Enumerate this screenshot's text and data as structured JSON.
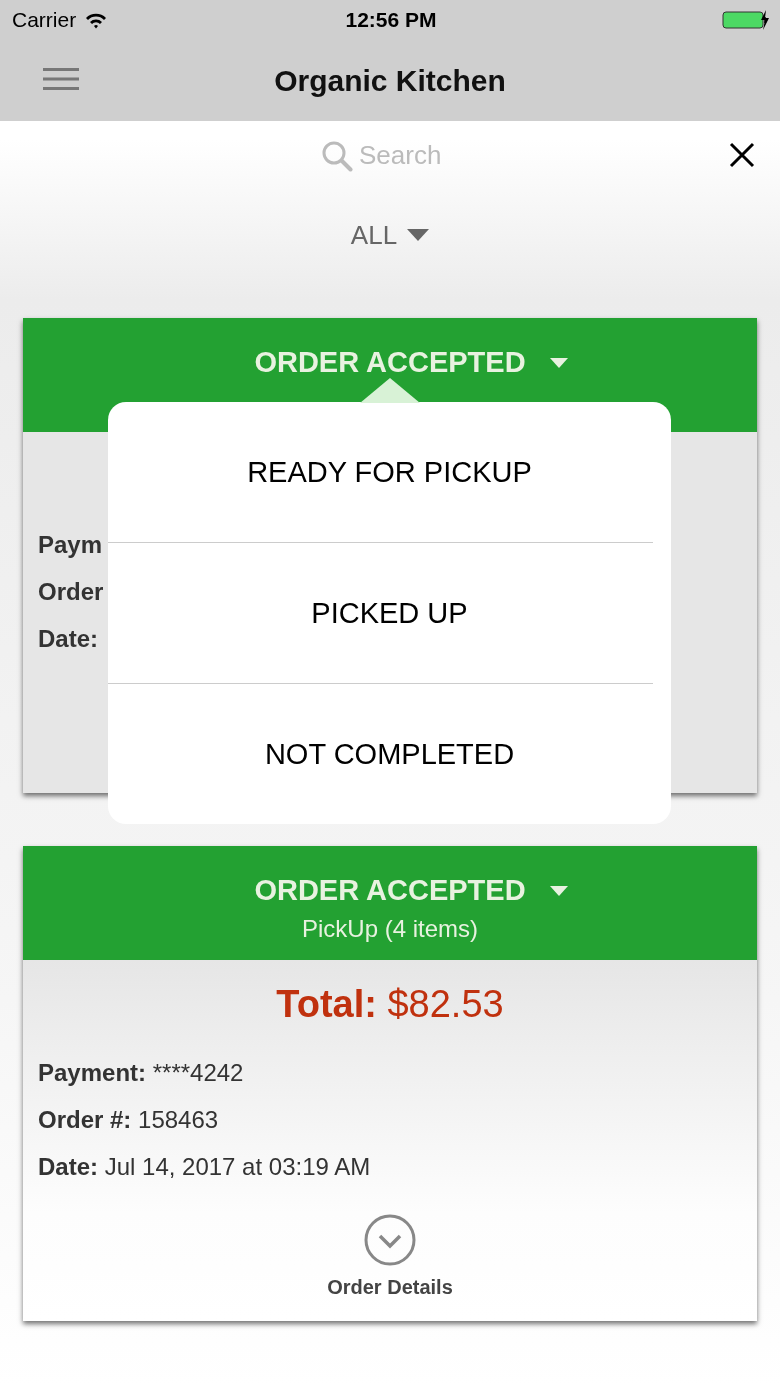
{
  "status_bar": {
    "carrier": "Carrier",
    "time": "12:56 PM"
  },
  "nav": {
    "title": "Organic Kitchen"
  },
  "search": {
    "placeholder": "Search"
  },
  "filter": {
    "label": "ALL"
  },
  "orders": [
    {
      "status": "ORDER ACCEPTED",
      "rows": [
        {
          "label": "Paym"
        },
        {
          "label": "Order"
        },
        {
          "label": "Date:"
        }
      ]
    },
    {
      "status": "ORDER ACCEPTED",
      "subtitle": "PickUp (4 items)",
      "total": "**Total:** $82.53",
      "rows": [
        {
          "label": "Payment:",
          "value": "****4242"
        },
        {
          "label": "Order #:",
          "value": "158463"
        },
        {
          "label": "Date:",
          "value": "Jul 14, 2017 at 03:19 AM"
        }
      ],
      "details": "Order Details"
    }
  ],
  "status_menu": {
    "items": [
      "READY FOR PICKUP",
      "PICKED UP",
      "NOT COMPLETED"
    ]
  }
}
